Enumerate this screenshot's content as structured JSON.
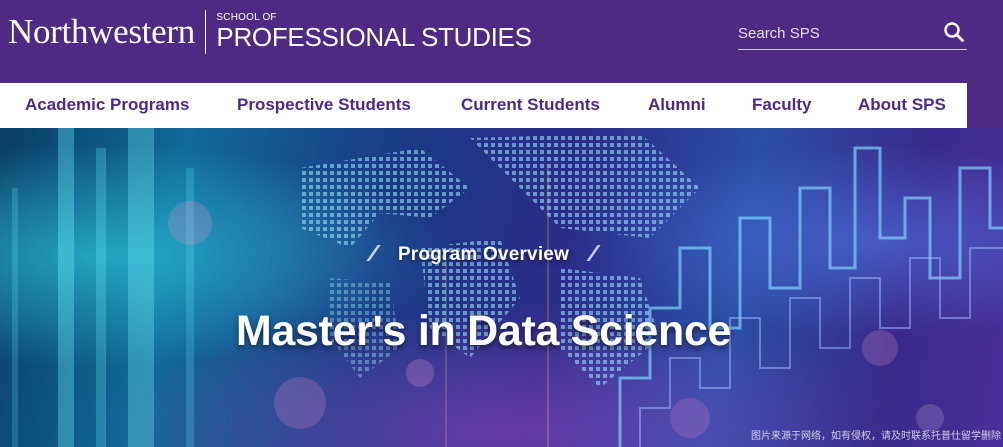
{
  "header": {
    "logo": {
      "wordmark": "Northwestern",
      "school_small": "SCHOOL OF",
      "school_big": "PROFESSIONAL STUDIES"
    },
    "search": {
      "placeholder": "Search SPS",
      "icon": "search-icon"
    }
  },
  "nav": {
    "items": [
      {
        "label": "Academic Programs"
      },
      {
        "label": "Prospective Students"
      },
      {
        "label": "Current Students"
      },
      {
        "label": "Alumni"
      },
      {
        "label": "Faculty"
      },
      {
        "label": "About SPS"
      }
    ]
  },
  "hero": {
    "eyebrow": "Program Overview",
    "title": "Master's in Data Science",
    "credit": "图片来源于网络，如有侵权，请及时联系托普仕留学删除"
  },
  "colors": {
    "brand_purple": "#4e2a84",
    "nav_bg": "#ffffff",
    "text_light": "#ffffff"
  }
}
